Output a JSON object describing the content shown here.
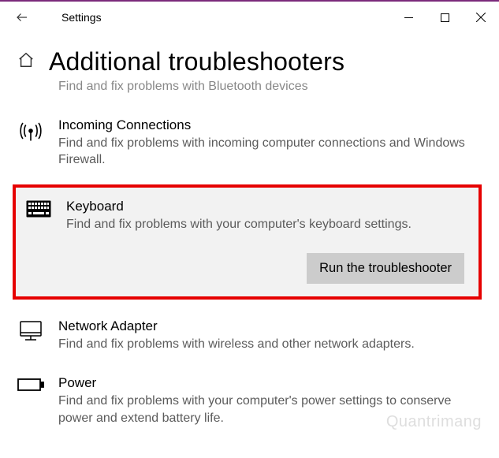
{
  "titlebar": {
    "app_title": "Settings"
  },
  "header": {
    "page_title": "Additional troubleshooters"
  },
  "truncated_top_desc": "Find and fix problems with Bluetooth devices",
  "items": {
    "incoming": {
      "title": "Incoming Connections",
      "desc": "Find and fix problems with incoming computer connections and Windows Firewall."
    },
    "keyboard": {
      "title": "Keyboard",
      "desc": "Find and fix problems with your computer's keyboard settings.",
      "button_label": "Run the troubleshooter"
    },
    "network": {
      "title": "Network Adapter",
      "desc": "Find and fix problems with wireless and other network adapters."
    },
    "power": {
      "title": "Power",
      "desc": "Find and fix problems with your computer's power settings to conserve power and extend battery life."
    }
  },
  "watermark": "Quantrimang"
}
